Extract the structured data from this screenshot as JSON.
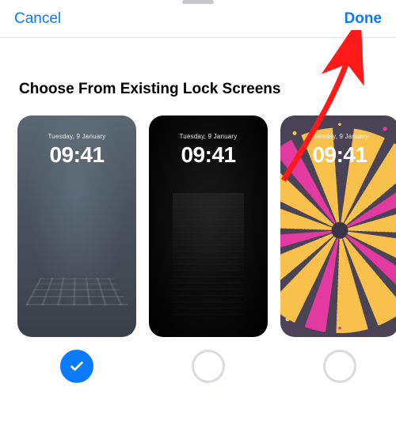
{
  "nav": {
    "cancel_label": "Cancel",
    "done_label": "Done"
  },
  "section": {
    "title": "Choose From Existing Lock Screens"
  },
  "lockscreens": [
    {
      "date": "Tuesday, 9 January",
      "time": "09:41",
      "selected": true,
      "wallpaper": "foggy-city-crosswalk"
    },
    {
      "date": "Tuesday, 9 January",
      "time": "09:41",
      "selected": false,
      "wallpaper": "dark-night-street"
    },
    {
      "date": "Tuesday, 9 January",
      "time": "09:41",
      "selected": false,
      "wallpaper": "emoji-spiral"
    }
  ],
  "colors": {
    "tint": "#0a7aff",
    "annotation": "#ff1a1a"
  },
  "annotation": {
    "type": "arrow",
    "points_to": "done-button"
  }
}
